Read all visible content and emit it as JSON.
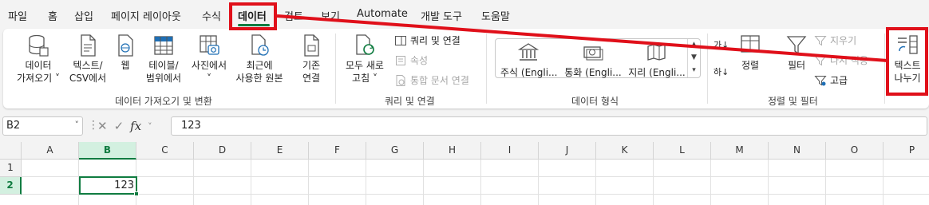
{
  "tabs": [
    {
      "label": "파일"
    },
    {
      "label": "홈"
    },
    {
      "label": "삽입"
    },
    {
      "label": "페이지 레이아웃"
    },
    {
      "label": "수식"
    },
    {
      "label": "데이터"
    },
    {
      "label": "검토"
    },
    {
      "label": "보기"
    },
    {
      "label": "Automate"
    },
    {
      "label": "개발 도구"
    },
    {
      "label": "도움말"
    }
  ],
  "active_tab": "데이터",
  "ribbon": {
    "get_data": {
      "line1": "데이터",
      "line2": "가져오기 ˅"
    },
    "text_csv": {
      "line1": "텍스트/",
      "line2": "CSV에서"
    },
    "web": {
      "line1": "웹"
    },
    "table_range": {
      "line1": "테이블/",
      "line2": "범위에서"
    },
    "from_picture": {
      "line1": "사진에서",
      "line2": "˅"
    },
    "recent_sources": {
      "line1": "최근에",
      "line2": "사용한 원본"
    },
    "existing_conn": {
      "line1": "기존",
      "line2": "연결"
    },
    "group_get_transform": "데이터 가져오기 및 변환",
    "refresh_all": {
      "line1": "모두 새로",
      "line2": "고침 ˅"
    },
    "queries_connections": "쿼리 및 연결",
    "properties": "속성",
    "edit_links": "통합 문서 연결",
    "group_queries": "쿼리 및 연결",
    "data_types": [
      {
        "label": "주식 (Engli..."
      },
      {
        "label": "통화 (Engli..."
      },
      {
        "label": "지리 (Engli..."
      }
    ],
    "group_data_types": "데이터 형식",
    "sort_az": "가↓",
    "sort_za": "하↓",
    "sort": "정렬",
    "filter": "필터",
    "clear": "지우기",
    "reapply": "다시 적용",
    "advanced": "고급",
    "group_sort_filter": "정렬 및 필터",
    "text_to_columns": {
      "line1": "텍스트",
      "line2": "나누기"
    }
  },
  "formula_bar": {
    "name_box": "B2",
    "name_box_arrow": "˅",
    "more": "⋮",
    "cancel": "✕",
    "enter": "✓",
    "fx": "fx",
    "fx_arrow": "˅",
    "value": "123"
  },
  "grid": {
    "columns": [
      "A",
      "B",
      "C",
      "D",
      "E",
      "F",
      "G",
      "H",
      "I",
      "J",
      "K",
      "L",
      "M",
      "N",
      "O",
      "P"
    ],
    "selected_column": "B",
    "rows": [
      "1",
      "2"
    ],
    "selected_row": "2",
    "active_cell": {
      "ref": "B2",
      "value": "123"
    }
  },
  "colors": {
    "accent": "#107c41",
    "annotation": "#e0101a"
  }
}
